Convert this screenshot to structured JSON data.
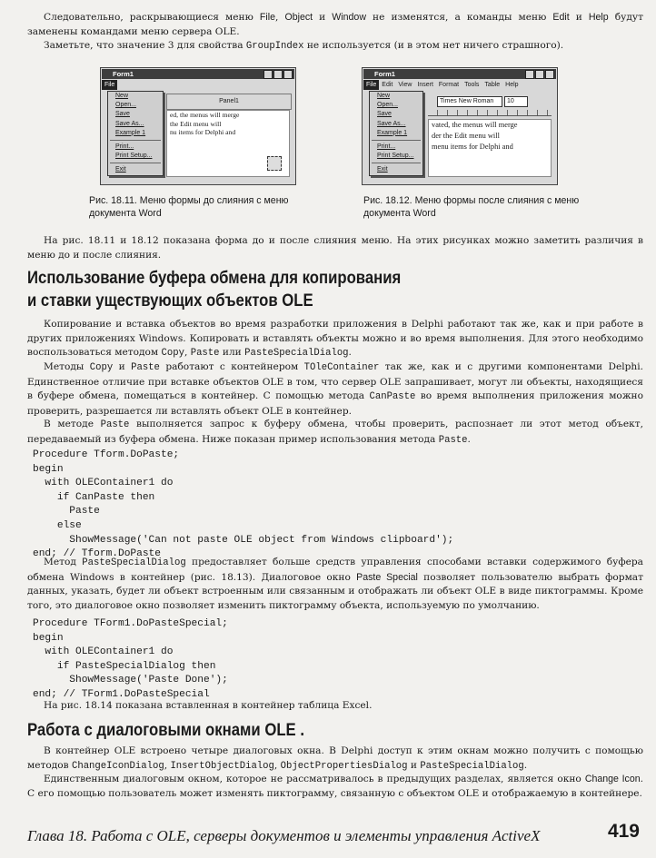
{
  "intro": {
    "line1_a": "Следовательно, раскрывающиеся меню ",
    "line1_file": "File",
    "line1_b": ", ",
    "line1_object": "Object",
    "line1_c": " и ",
    "line1_window": "Window",
    "line1_d": " не изменятся, а команды меню ",
    "line1_edit": "Edit",
    "line1_e": " и ",
    "line1_help": "Help",
    "line1_f": " будут заменены командами меню сервера OLE.",
    "line2_a": "Заметьте, что значение 3 для свойства ",
    "line2_code": "GroupIndex",
    "line2_b": " не используется (и в этом нет ничего страшного)."
  },
  "figures": {
    "fig1": {
      "title": "Form1",
      "menu_file": "File",
      "panel": "Panel1",
      "items": [
        "New",
        "Open...",
        "Save",
        "Save As...",
        "Example 1",
        "Print...",
        "Print Setup...",
        "Exit"
      ],
      "doc_lines": [
        "ed, the menus will merge",
        "the Edit menu will",
        "nu items for Delphi and"
      ],
      "caption": "Рис. 18.11. Меню формы до слияния с меню документа Word"
    },
    "fig2": {
      "title": "Form1",
      "menus": [
        "File",
        "Edit",
        "View",
        "Insert",
        "Format",
        "Tools",
        "Table",
        "Help"
      ],
      "font_name": "Times New Roman",
      "font_size": "10",
      "items": [
        "New",
        "Open...",
        "Save",
        "Save As...",
        "Example 1",
        "Print...",
        "Print Setup...",
        "Exit"
      ],
      "doc_lines": [
        "vated, the menus will merge",
        "der the Edit menu will",
        "menu items for Delphi and"
      ],
      "caption": "Рис. 18.12. Меню формы после слияния с меню документа Word"
    }
  },
  "para_compare": "На рис. 18.11 и 18.12 показана форма до и после слияния меню. На этих рисунках можно заметить различия в меню до и после слияния.",
  "heading1": {
    "line1": "Использование буфера обмена для копирования",
    "line2": "и ставки уществующих объектов OLE"
  },
  "clipboard": {
    "p1_a": "Копирование и вставка объектов во время разработки приложения в Delphi работают так же, как и при работе в других приложениях Windows. Копировать и вставлять объекты можно и во время выполнения. Для этого необходимо воспользоваться методом ",
    "p1_copy": "Copy",
    "p1_b": ", ",
    "p1_paste": "Paste",
    "p1_c": " или ",
    "p1_psd": "PasteSpecialDialog",
    "p1_d": ".",
    "p2_a": "Методы ",
    "p2_copy": "Copy",
    "p2_b": " и ",
    "p2_paste": "Paste",
    "p2_c": " работают с контейнером ",
    "p2_cont": "TOleContainer",
    "p2_d": " так же, как и с другими компонентами Delphi. Единственное отличие при вставке объектов OLE в том, что сервер OLE запрашивает, могут ли объекты, находящиеся в буфере обмена, помещаться в контейнер. С помощью метода ",
    "p2_canpaste": "CanPaste",
    "p2_e": " во время выполнения приложения можно проверить, разрешается ли вставлять объект OLE в контейнер.",
    "p3_a": "В методе ",
    "p3_paste": "Paste",
    "p3_b": " выполняется запрос к буферу обмена, чтобы проверить, распознает ли этот метод объект, передаваемый из буфера обмена. Ниже показан пример использования метода ",
    "p3_paste2": "Paste",
    "p3_c": "."
  },
  "code1": "Procedure Tform.DoPaste;\nbegin\n  with OLEContainer1 do\n    if CanPaste then\n      Paste\n    else\n      ShowMessage('Can not paste OLE object from Windows clipboard');\nend; // Tform.DoPaste",
  "psd": {
    "p_a": "Метод ",
    "p_code": "PasteSpecialDialog",
    "p_b": " предоставляет больше средств управления способами вставки содержимого буфера обмена Windows в контейнер (рис. 18.13). Диалоговое окно ",
    "p_dialog": "Paste Special",
    "p_c": " позволяет пользователю выбрать формат данных, указать, будет ли объект встроенным или связанным и отображать ли объект OLE в виде пиктограммы. Кроме того, это диалоговое окно позволяет изменить пиктограмму объекта, используемую по умолчанию."
  },
  "code2": "Procedure TForm1.DoPasteSpecial;\nbegin\n  with OLEContainer1 do\n    if PasteSpecialDialog then\n      ShowMessage('Paste Done');\nend; // TForm1.DoPasteSpecial",
  "para_excel": "На рис. 18.14 показана вставленная в контейнер таблица Excel.",
  "heading2": "Работа с диалоговыми окнами OLE",
  "heading2_dot": ".",
  "dialogs": {
    "p1_a": "В контейнер OLE встроено четыре диалоговых окна. В Delphi доступ к этим окнам можно получить с помощью методов ",
    "p1_m1": "ChangeIconDialog",
    "p1_s1": ", ",
    "p1_m2": "InsertObjectDialog",
    "p1_s2": ", ",
    "p1_m3": "ObjectPropertiesDialog",
    "p1_s3": " и ",
    "p1_m4": "PasteSpecialDialog",
    "p1_b": ".",
    "p2_a": "Единственным диалоговым окном, которое не рассматривалось в предыдущих разделах, является окно ",
    "p2_name": "Change Icon",
    "p2_b": ". С его помощью пользователь может изменять пиктограмму, связанную с объектом OLE и отображаемую в контейнере."
  },
  "footer": {
    "chapter": "Глава 18. Работа с OLE, серверы документов и элементы управления ActiveX",
    "page": "419"
  }
}
